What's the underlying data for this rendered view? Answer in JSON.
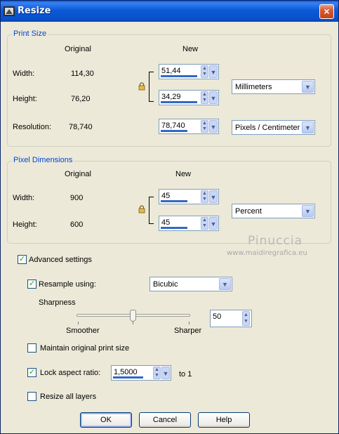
{
  "window": {
    "title": "Resize",
    "close_glyph": "×"
  },
  "print_size": {
    "title": "Print Size",
    "original_header": "Original",
    "new_header": "New",
    "width_label": "Width:",
    "width_original": "114,30",
    "width_new": "51,44",
    "height_label": "Height:",
    "height_original": "76,20",
    "height_new": "34,29",
    "units": "Millimeters",
    "resolution_label": "Resolution:",
    "resolution_original": "78,740",
    "resolution_new": "78,740",
    "resolution_units": "Pixels / Centimeter"
  },
  "pixel_dimensions": {
    "title": "Pixel Dimensions",
    "original_header": "Original",
    "new_header": "New",
    "width_label": "Width:",
    "width_original": "900",
    "width_new": "45",
    "height_label": "Height:",
    "height_original": "600",
    "height_new": "45",
    "units": "Percent"
  },
  "watermark": {
    "name": "Pinuccia",
    "url": "www.maidiregrafica.eu"
  },
  "advanced": {
    "label": "Advanced settings",
    "checked": true,
    "resample_label": "Resample using:",
    "resample_checked": true,
    "resample_method": "Bicubic",
    "sharpness_label": "Sharpness",
    "sharpness_value": "50",
    "sharpness_fraction": 0.5,
    "smoother_label": "Smoother",
    "sharper_label": "Sharper",
    "maintain_label": "Maintain original print size",
    "maintain_checked": false,
    "lock_label": "Lock aspect ratio:",
    "lock_checked": true,
    "lock_value": "1,5000",
    "lock_suffix": "to 1",
    "resize_layers_label": "Resize all layers",
    "resize_layers_checked": false
  },
  "buttons": {
    "ok": "OK",
    "cancel": "Cancel",
    "help": "Help"
  },
  "icons": {
    "app": "paint-shop-icon",
    "lock": "padlock-icon",
    "spin": "up-down-arrows-icon",
    "dropdown": "chevron-down-icon",
    "check": "checkmark-icon"
  },
  "colors": {
    "titlebar": "#0b5ad6",
    "window_bg": "#ece9d8",
    "group_title": "#0046d5",
    "field_bar": "#3169c6",
    "check": "#21a121"
  }
}
